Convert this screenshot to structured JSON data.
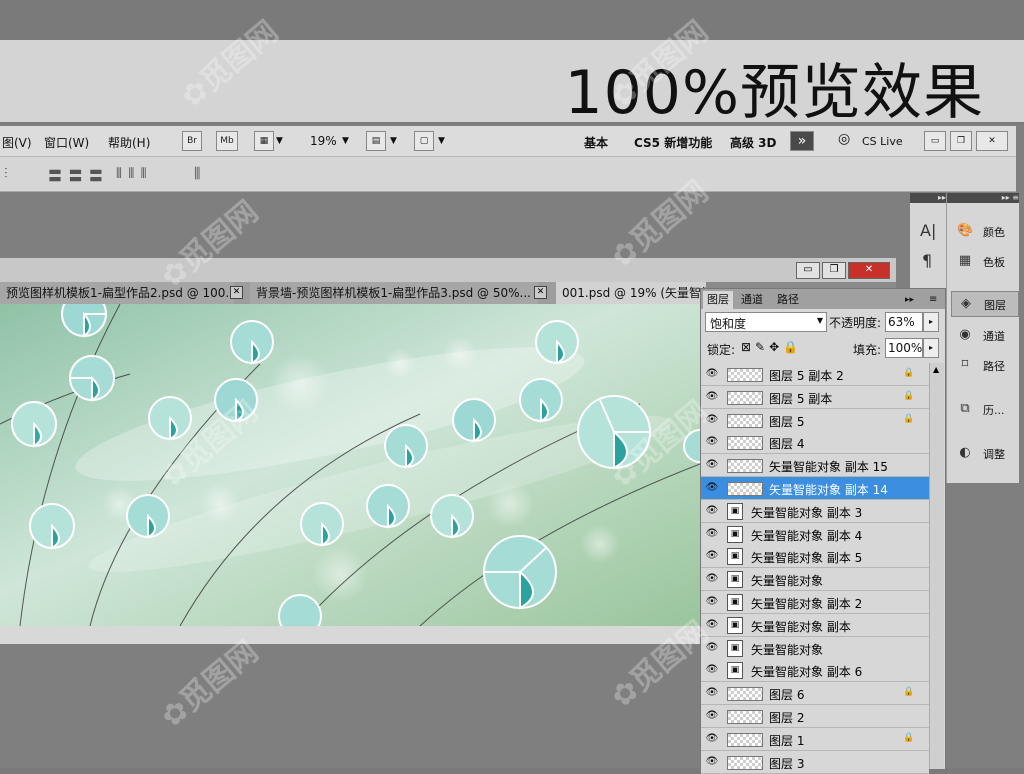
{
  "banner": {
    "title": "100%预览效果"
  },
  "menubar": {
    "items": [
      "图(V)",
      "窗口(W)",
      "帮助(H)"
    ],
    "bridge_btn": "Br",
    "mini_bridge_btn": "Mb",
    "zoom": "19%",
    "workspaces": [
      "基本",
      "CS5 新增功能",
      "高级 3D"
    ],
    "cs_live": "CS Live"
  },
  "document": {
    "tabs": [
      {
        "label": "预览图样机模板1-扁型作品2.psd @ 100..."
      },
      {
        "label": "背景墙-预览图样机模板1-扁型作品3.psd @ 50%..."
      },
      {
        "label": "001.psd @ 19% (矢量智能"
      }
    ]
  },
  "dock": {
    "items": [
      "颜色",
      "色板",
      "图层",
      "通道",
      "路径",
      "历...",
      "调整"
    ]
  },
  "layers_panel": {
    "tabs": [
      "图层",
      "通道",
      "路径"
    ],
    "blend_mode": "饱和度",
    "opacity_label": "不透明度:",
    "opacity": "63%",
    "lock_label": "锁定:",
    "fill_label": "填充:",
    "fill": "100%",
    "layers": [
      {
        "name": "图层 5 副本 2",
        "type": "raster",
        "locked": true,
        "selected": false
      },
      {
        "name": "图层 5 副本",
        "type": "raster",
        "locked": true,
        "selected": false
      },
      {
        "name": "图层 5",
        "type": "raster",
        "locked": true,
        "selected": false
      },
      {
        "name": "图层 4",
        "type": "raster",
        "locked": false,
        "selected": false
      },
      {
        "name": "矢量智能对象 副本 15",
        "type": "raster",
        "locked": false,
        "selected": false
      },
      {
        "name": "矢量智能对象 副本 14",
        "type": "raster",
        "locked": false,
        "selected": true
      },
      {
        "name": "矢量智能对象 副本 3",
        "type": "smart",
        "locked": false,
        "selected": false
      },
      {
        "name": "矢量智能对象 副本 4",
        "type": "smart",
        "locked": false,
        "selected": false
      },
      {
        "name": "矢量智能对象 副本 5",
        "type": "smart",
        "locked": false,
        "selected": false
      },
      {
        "name": "矢量智能对象",
        "type": "smart",
        "locked": false,
        "selected": false
      },
      {
        "name": "矢量智能对象 副本 2",
        "type": "smart",
        "locked": false,
        "selected": false
      },
      {
        "name": "矢量智能对象 副本",
        "type": "smart",
        "locked": false,
        "selected": false
      },
      {
        "name": "矢量智能对象",
        "type": "smart",
        "locked": false,
        "selected": false
      },
      {
        "name": "矢量智能对象 副本 6",
        "type": "smart",
        "locked": false,
        "selected": false
      },
      {
        "name": "图层 6",
        "type": "raster",
        "locked": true,
        "selected": false
      },
      {
        "name": "图层 2",
        "type": "raster",
        "locked": false,
        "selected": false
      },
      {
        "name": "图层 1",
        "type": "raster",
        "locked": true,
        "selected": false
      },
      {
        "name": "图层 3",
        "type": "raster",
        "locked": false,
        "selected": false
      }
    ]
  },
  "colors": {
    "selection": "#3c8fe0",
    "canvas_green": "#a6ccaa",
    "teal": "#35a6a4"
  }
}
